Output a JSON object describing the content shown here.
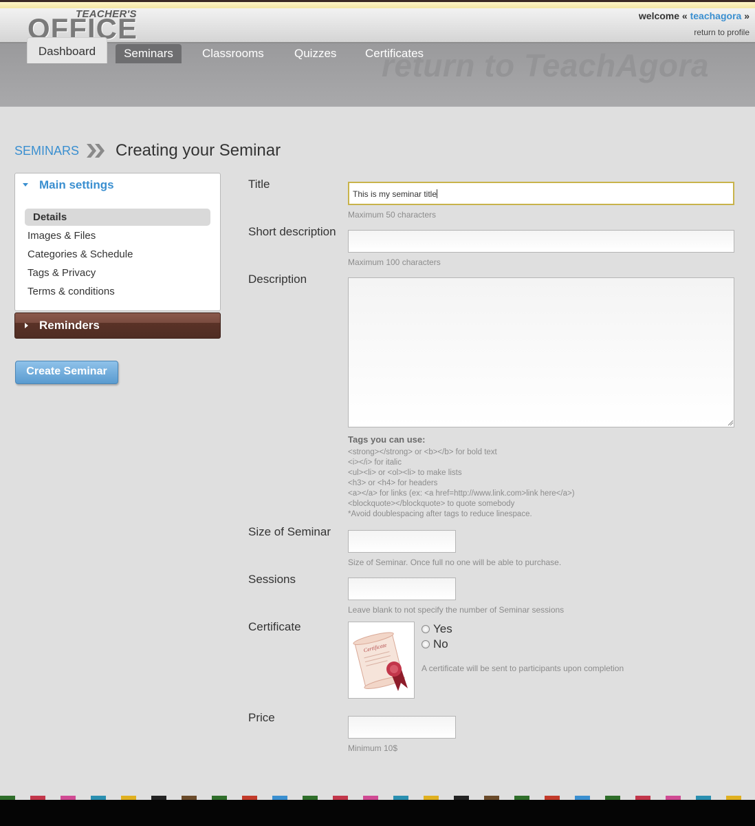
{
  "header": {
    "logo_top": "TEACHER'S",
    "logo_main": "OFFICE",
    "welcome_prefix": "welcome «",
    "username": "teachagora",
    "welcome_suffix": "»",
    "return_profile": "return to profile"
  },
  "banner": {
    "return_link": "return to TeachAgora"
  },
  "tabs": [
    {
      "label": "Dashboard"
    },
    {
      "label": "Seminars"
    },
    {
      "label": "Classrooms"
    },
    {
      "label": "Quizzes"
    },
    {
      "label": "Certificates"
    }
  ],
  "breadcrumb": {
    "link": "SEMINARS",
    "title": "Creating your Seminar"
  },
  "sidebar": {
    "main_settings": "Main settings",
    "items": [
      "Details",
      "Images & Files",
      "Categories & Schedule",
      "Tags & Privacy",
      "Terms & conditions"
    ],
    "reminders": "Reminders",
    "create_button": "Create Seminar"
  },
  "form": {
    "title": {
      "label": "Title",
      "value": "This is my seminar title",
      "hint": "Maximum 50 characters"
    },
    "short_description": {
      "label": "Short description",
      "value": "",
      "hint": "Maximum 100 characters"
    },
    "description": {
      "label": "Description",
      "value": "",
      "tags_title": "Tags you can use:",
      "tags": [
        "<strong></strong> or <b></b> for bold text",
        "<i></i> for italic",
        "<ul><li> or <ol><li> to make lists",
        "<h3> or <h4> for headers",
        "<a></a> for links (ex: <a href=http://www.link.com>link here</a>)",
        "<blockquote></blockquote> to quote somebody",
        "*Avoid doublespacing after tags to reduce linespace."
      ]
    },
    "size": {
      "label": "Size of Seminar",
      "value": "",
      "hint": "Size of Seminar. Once full no one will be able to purchase."
    },
    "sessions": {
      "label": "Sessions",
      "value": "",
      "hint": "Leave blank to not specify the number of Seminar sessions"
    },
    "certificate": {
      "label": "Certificate",
      "image_text": "Certificate",
      "options": [
        "Yes",
        "No"
      ],
      "selected": null,
      "hint": "A certificate will be sent to participants upon completion"
    },
    "price": {
      "label": "Price",
      "value": "",
      "hint": "Minimum 10$"
    }
  },
  "colors": {
    "accent": "#3a8fd0",
    "reminders_bg": "#5a3227",
    "create_button": "#6aa8da"
  }
}
